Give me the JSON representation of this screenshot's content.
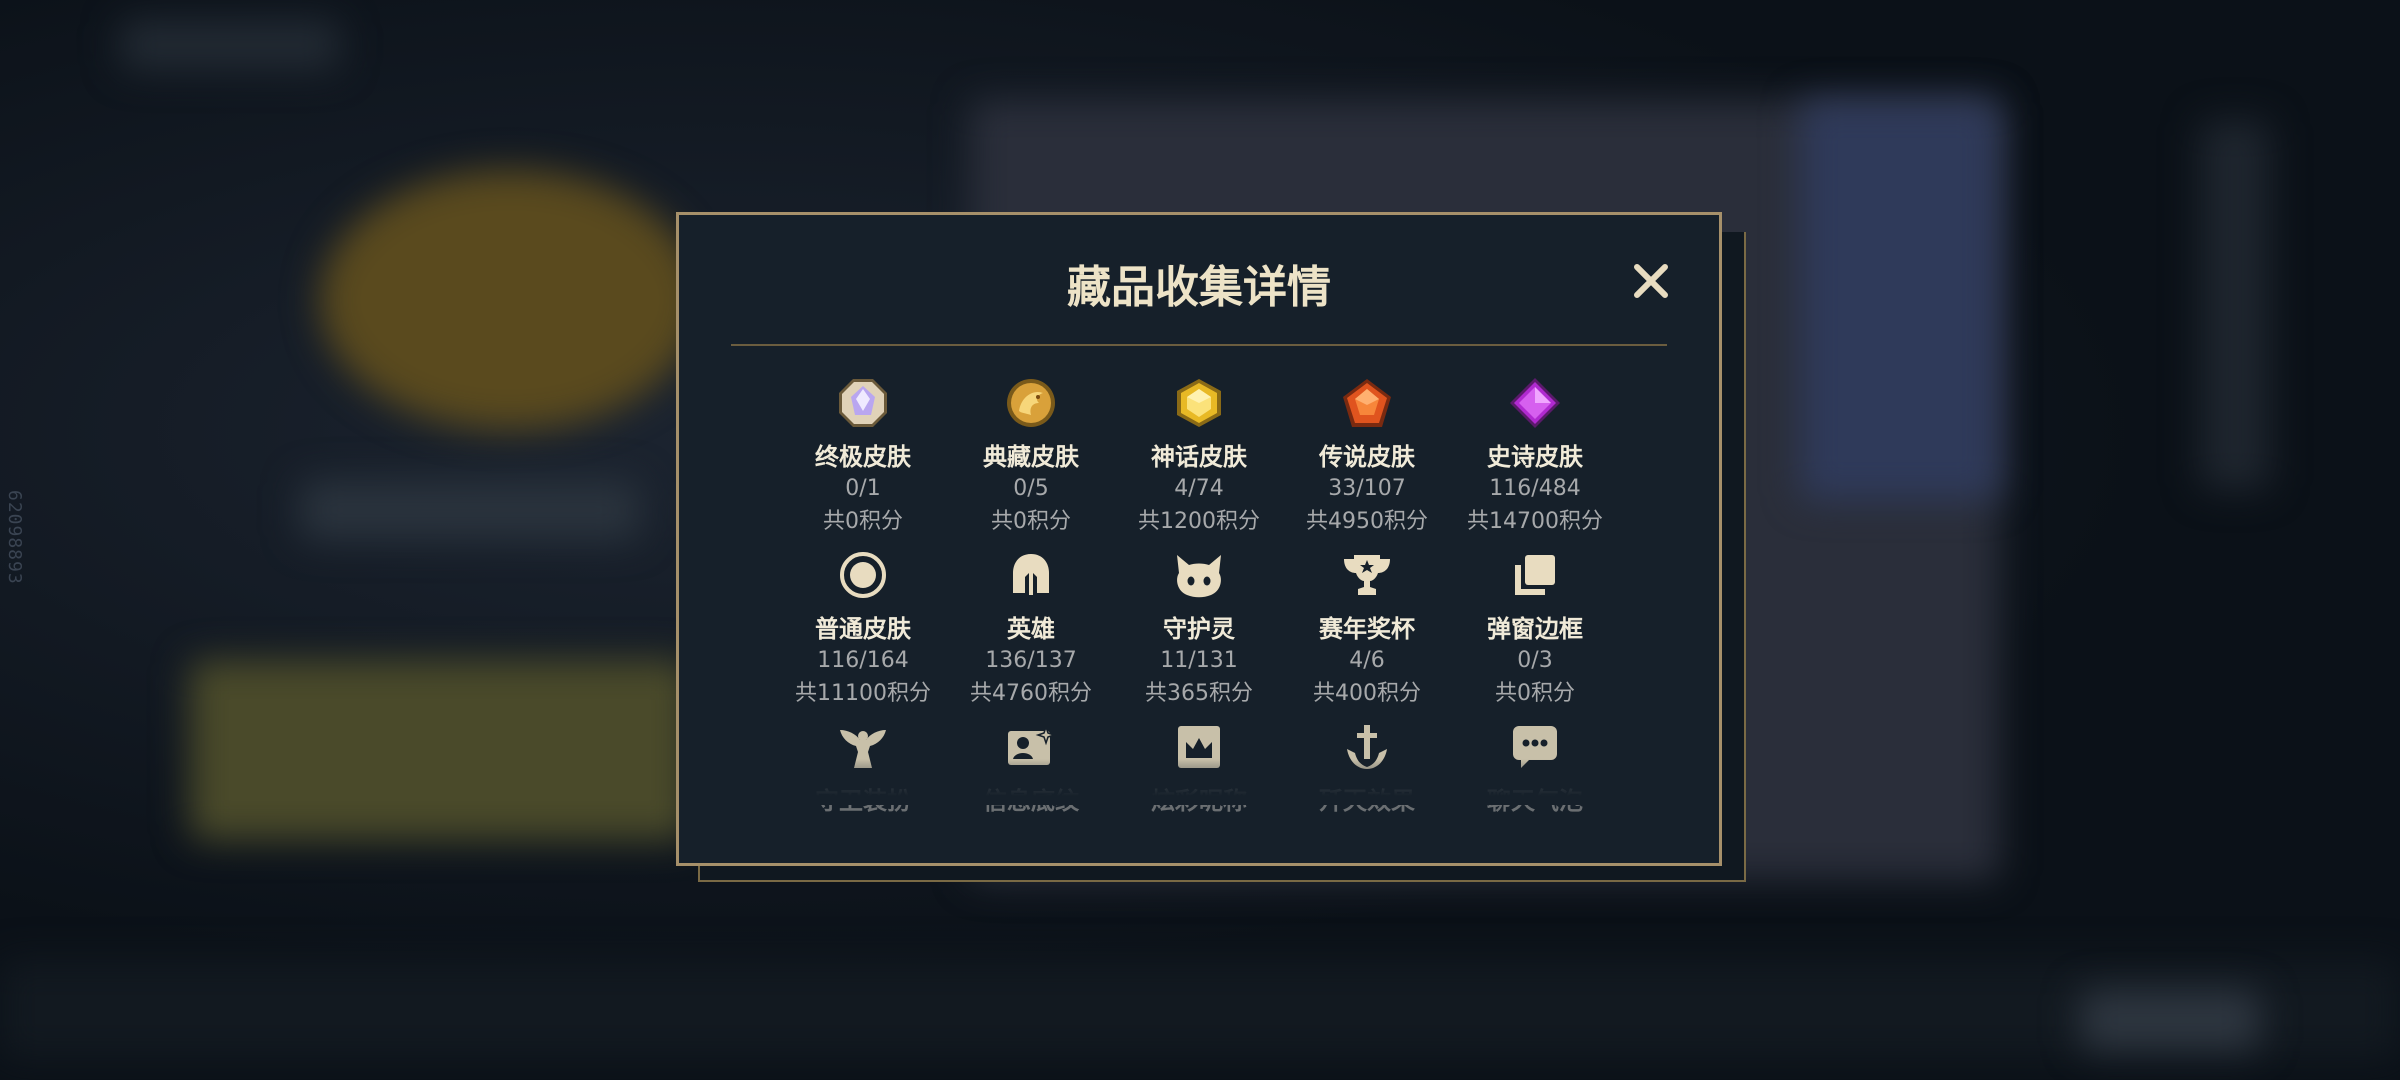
{
  "modal": {
    "title": "藏品收集详情",
    "close_icon": "close-icon"
  },
  "side_id": "62098893",
  "rows": [
    [
      {
        "icon": "ultimate-skin-icon",
        "label": "终极皮肤",
        "count": "0/1",
        "points": "共0积分"
      },
      {
        "icon": "treasure-skin-icon",
        "label": "典藏皮肤",
        "count": "0/5",
        "points": "共0积分"
      },
      {
        "icon": "mythic-skin-icon",
        "label": "神话皮肤",
        "count": "4/74",
        "points": "共1200积分"
      },
      {
        "icon": "legendary-skin-icon",
        "label": "传说皮肤",
        "count": "33/107",
        "points": "共4950积分"
      },
      {
        "icon": "epic-skin-icon",
        "label": "史诗皮肤",
        "count": "116/484",
        "points": "共14700积分"
      }
    ],
    [
      {
        "icon": "common-skin-icon",
        "label": "普通皮肤",
        "count": "116/164",
        "points": "共11100积分"
      },
      {
        "icon": "champion-helmet-icon",
        "label": "英雄",
        "count": "136/137",
        "points": "共4760积分"
      },
      {
        "icon": "guardian-spirit-icon",
        "label": "守护灵",
        "count": "11/131",
        "points": "共365积分"
      },
      {
        "icon": "trophy-icon",
        "label": "赛年奖杯",
        "count": "4/6",
        "points": "共400积分"
      },
      {
        "icon": "popup-frame-icon",
        "label": "弹窗边框",
        "count": "0/3",
        "points": "共0积分"
      }
    ],
    [
      {
        "icon": "ward-skin-icon",
        "label": "守卫装扮"
      },
      {
        "icon": "info-card-icon",
        "label": "信息底纹"
      },
      {
        "icon": "colorful-nickname-icon",
        "label": "炫彩昵称"
      },
      {
        "icon": "elimination-effect-icon",
        "label": "歼灭效果"
      },
      {
        "icon": "chat-bubble-icon",
        "label": "聊天气泡"
      }
    ]
  ],
  "colors": {
    "gold": "#c8aa6e",
    "border": "#a6906a",
    "panel": "#16202a"
  }
}
